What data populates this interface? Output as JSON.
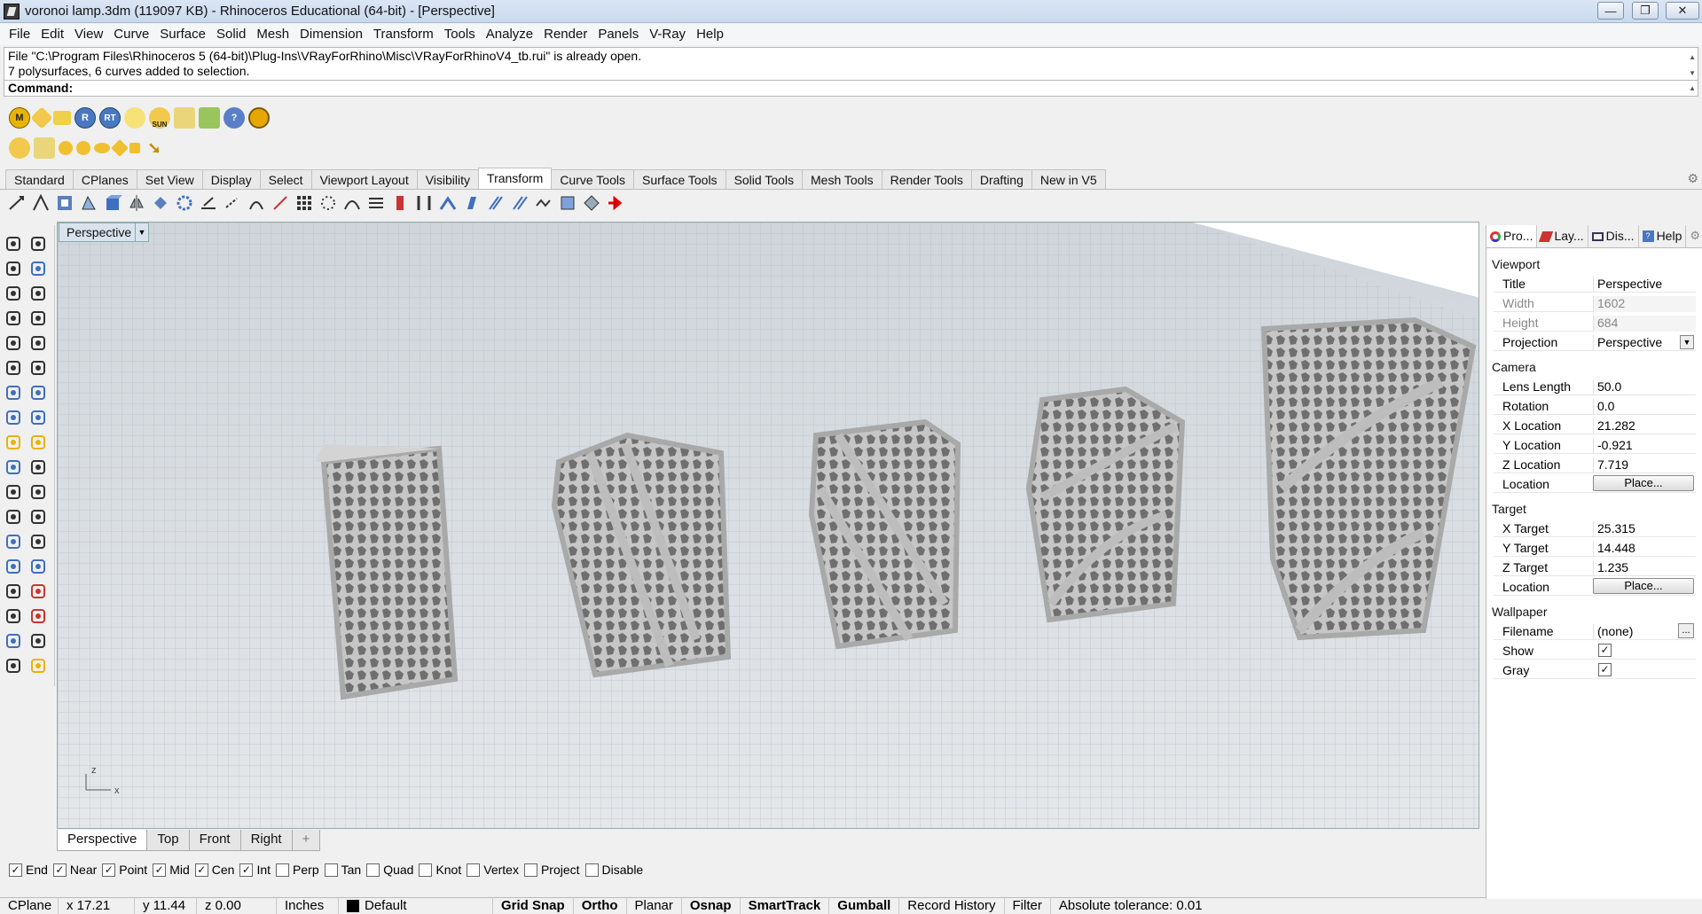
{
  "window": {
    "title": "voronoi lamp.3dm (119097 KB) - Rhinoceros Educational (64-bit) - [Perspective]",
    "min": "—",
    "max": "❐",
    "close": "✕"
  },
  "menu": [
    "File",
    "Edit",
    "View",
    "Curve",
    "Surface",
    "Solid",
    "Mesh",
    "Dimension",
    "Transform",
    "Tools",
    "Analyze",
    "Render",
    "Panels",
    "V-Ray",
    "Help"
  ],
  "command": {
    "history": [
      "File \"C:\\Program Files\\Rhinoceros 5 (64-bit)\\Plug-Ins\\VRayForRhino\\Misc\\VRayForRhinoV4_tb.rui\" is already open.",
      "7 polysurfaces, 6 curves added to selection."
    ],
    "prompt": "Command:"
  },
  "vray_toolbar": {
    "labels": [
      "M",
      "",
      "",
      "R",
      "RT",
      "",
      "SUN",
      "",
      "",
      "",
      "?",
      ""
    ]
  },
  "tool_tabs": [
    "Standard",
    "CPlanes",
    "Set View",
    "Display",
    "Select",
    "Viewport Layout",
    "Visibility",
    "Transform",
    "Curve Tools",
    "Surface Tools",
    "Solid Tools",
    "Mesh Tools",
    "Render Tools",
    "Drafting",
    "New in V5"
  ],
  "active_tool_tab": "Transform",
  "viewport": {
    "name": "Perspective",
    "axis": {
      "x": "x",
      "z": "z"
    }
  },
  "view_tabs": [
    "Perspective",
    "Top",
    "Front",
    "Right",
    "+"
  ],
  "active_view_tab": "Perspective",
  "osnaps": [
    {
      "label": "End",
      "checked": true
    },
    {
      "label": "Near",
      "checked": true
    },
    {
      "label": "Point",
      "checked": true
    },
    {
      "label": "Mid",
      "checked": true
    },
    {
      "label": "Cen",
      "checked": true
    },
    {
      "label": "Int",
      "checked": true
    },
    {
      "label": "Perp",
      "checked": false
    },
    {
      "label": "Tan",
      "checked": false
    },
    {
      "label": "Quad",
      "checked": false
    },
    {
      "label": "Knot",
      "checked": false
    },
    {
      "label": "Vertex",
      "checked": false
    },
    {
      "label": "Project",
      "checked": false
    },
    {
      "label": "Disable",
      "checked": false
    }
  ],
  "status": {
    "cplane": "CPlane",
    "x": "x 17.21",
    "y": "y 11.44",
    "z": "z 0.00",
    "units": "Inches",
    "layer": "Default",
    "grid_snap": "Grid Snap",
    "ortho": "Ortho",
    "planar": "Planar",
    "osnap": "Osnap",
    "smarttrack": "SmartTrack",
    "gumball": "Gumball",
    "record_history": "Record History",
    "filter": "Filter",
    "tolerance": "Absolute tolerance: 0.01"
  },
  "panel": {
    "tabs": [
      "Pro...",
      "Lay...",
      "Dis...",
      "Help"
    ],
    "viewport_header": "Viewport",
    "title_label": "Title",
    "title_value": "Perspective",
    "width_label": "Width",
    "width_value": "1602",
    "height_label": "Height",
    "height_value": "684",
    "projection_label": "Projection",
    "projection_value": "Perspective",
    "camera_header": "Camera",
    "lens_label": "Lens Length",
    "lens_value": "50.0",
    "rotation_label": "Rotation",
    "rotation_value": "0.0",
    "xloc_label": "X Location",
    "xloc_value": "21.282",
    "yloc_label": "Y Location",
    "yloc_value": "-0.921",
    "zloc_label": "Z Location",
    "zloc_value": "7.719",
    "location_label": "Location",
    "place_label": "Place...",
    "target_header": "Target",
    "xt_label": "X Target",
    "xt_value": "25.315",
    "yt_label": "Y Target",
    "yt_value": "14.448",
    "zt_label": "Z Target",
    "zt_value": "1.235",
    "tlocation_label": "Location",
    "tplace_label": "Place...",
    "wallpaper_header": "Wallpaper",
    "filename_label": "Filename",
    "filename_value": "(none)",
    "browse_label": "...",
    "show_label": "Show",
    "gray_label": "Gray",
    "check": "✓"
  },
  "colors": {
    "accent": "#d9e3ee",
    "grid": "#9aa3ab",
    "lamp": "#c9c9c9"
  }
}
